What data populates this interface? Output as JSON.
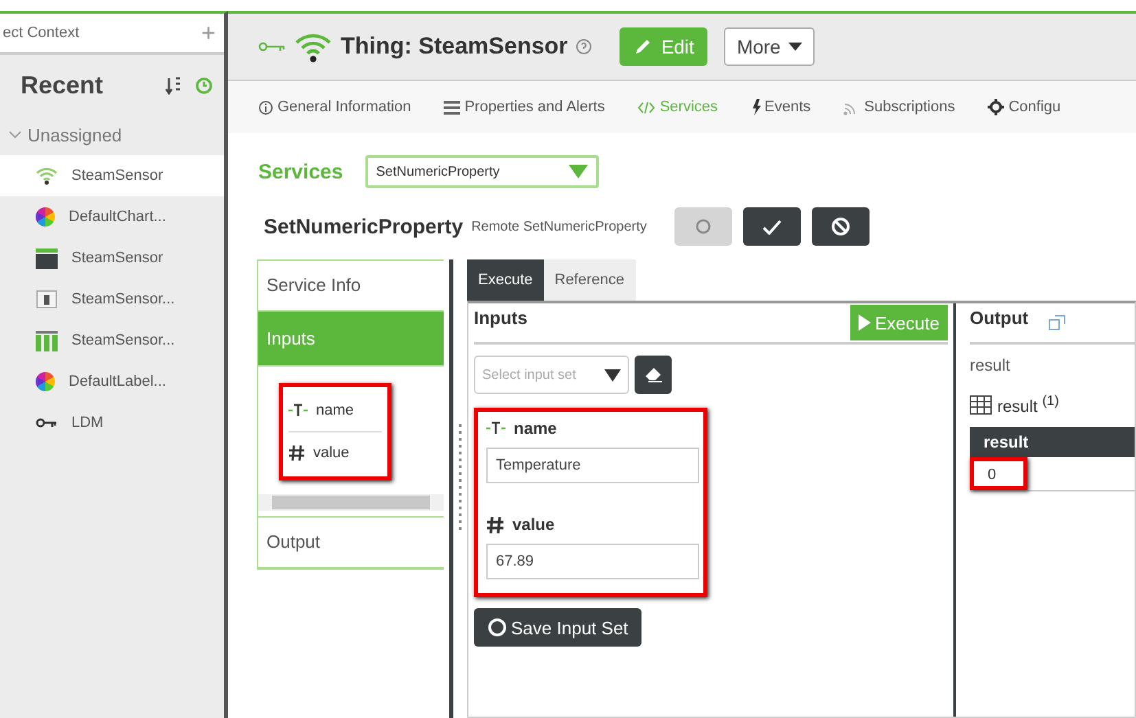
{
  "sidebar": {
    "search": {
      "value": "ect Context"
    },
    "add": "+",
    "recent": "Recent",
    "group": {
      "label": "Unassigned",
      "expanded": true
    },
    "items": [
      {
        "label": "SteamSensor",
        "kind": "thing",
        "selected": true
      },
      {
        "label": "DefaultChart...",
        "kind": "chart",
        "selected": false
      },
      {
        "label": "SteamSensor",
        "kind": "mashup",
        "selected": false
      },
      {
        "label": "SteamSensor...",
        "kind": "media",
        "selected": false
      },
      {
        "label": "SteamSensor...",
        "kind": "table",
        "selected": false
      },
      {
        "label": "DefaultLabel...",
        "kind": "chart",
        "selected": false
      },
      {
        "label": "LDM",
        "kind": "key",
        "selected": false
      }
    ]
  },
  "header": {
    "title": "Thing: SteamSensor",
    "edit": "Edit",
    "more": "More"
  },
  "tabs": [
    {
      "label": "General Information",
      "kind": "info",
      "selected": false
    },
    {
      "label": "Properties and Alerts",
      "kind": "list",
      "selected": false
    },
    {
      "label": "Services",
      "kind": "code",
      "selected": true
    },
    {
      "label": "Events",
      "kind": "bolt",
      "selected": false
    },
    {
      "label": "Subscriptions",
      "kind": "feed",
      "selected": false
    },
    {
      "label": "Configu",
      "kind": "gear",
      "selected": false
    }
  ],
  "services": {
    "label": "Services",
    "selected": "SetNumericProperty"
  },
  "service": {
    "name": "SetNumericProperty",
    "description": "Remote SetNumericProperty"
  },
  "nav": {
    "items": [
      {
        "label": "Service Info",
        "selected": false
      },
      {
        "label": "Inputs",
        "selected": true
      },
      {
        "label": "Output",
        "selected": false
      }
    ],
    "parameters": [
      {
        "name": "name",
        "kind": "string"
      },
      {
        "name": "value",
        "kind": "number"
      }
    ],
    "highlighted": true
  },
  "exec_tabs": [
    {
      "label": "Execute",
      "selected": true
    },
    {
      "label": "Reference",
      "selected": false
    }
  ],
  "inputs": {
    "title": "Inputs",
    "execute": "Execute",
    "input_set": {
      "placeholder": "Select input set"
    },
    "fields": [
      {
        "label": "name",
        "kind": "string",
        "value": "Temperature"
      },
      {
        "label": "value",
        "kind": "number",
        "value": "67.89"
      }
    ],
    "highlighted": true,
    "save": "Save Input Set"
  },
  "output": {
    "title": "Output",
    "label": "result",
    "table": "result $^{(1)}$",
    "column": "result",
    "rows": [
      "0"
    ],
    "highlighted": true
  }
}
